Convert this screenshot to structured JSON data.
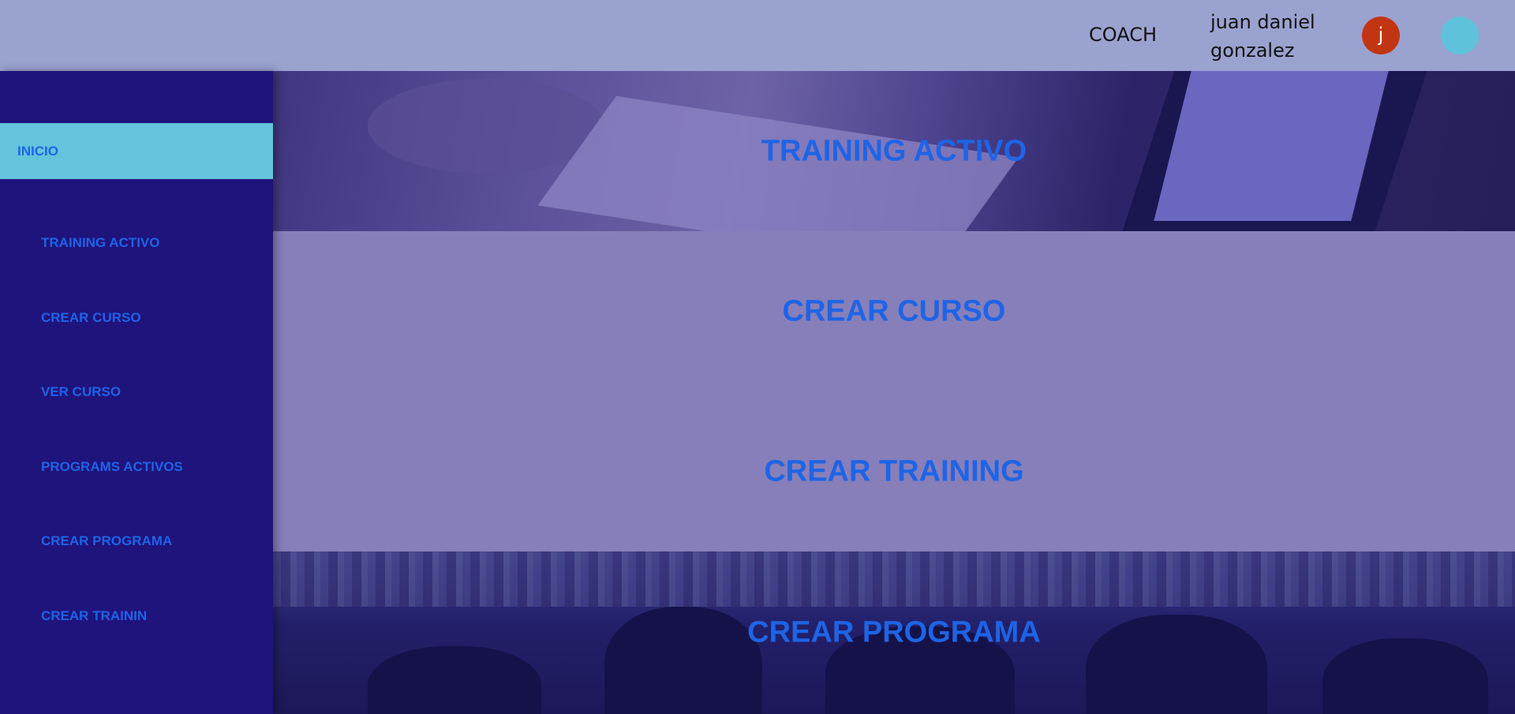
{
  "header": {
    "role": "COACH",
    "user_name": "juan daniel gonzalez",
    "avatar_initial": "j"
  },
  "sidebar": {
    "home_label": "INICIO",
    "items": [
      {
        "label": "TRAINING ACTIVO"
      },
      {
        "label": "CREAR CURSO"
      },
      {
        "label": "VER CURSO"
      },
      {
        "label": "PROGRAMS ACTIVOS"
      },
      {
        "label": "CREAR PROGRAMA"
      },
      {
        "label": "CREAR TRAININ"
      }
    ]
  },
  "main": {
    "banners": [
      {
        "title": "TRAINING ACTIVO"
      },
      {
        "title": "CREAR CURSO"
      },
      {
        "title": "CREAR TRAINING"
      },
      {
        "title": "CREAR PROGRAMA"
      }
    ]
  },
  "colors": {
    "topbar": "#9aa2cf",
    "sidebar": "#1f137c",
    "active_item": "#63c4dc",
    "link_text": "#1e64e6",
    "avatar": "#c23512",
    "circle_button": "#5ec3da",
    "banner_plain": "#877fb9"
  }
}
